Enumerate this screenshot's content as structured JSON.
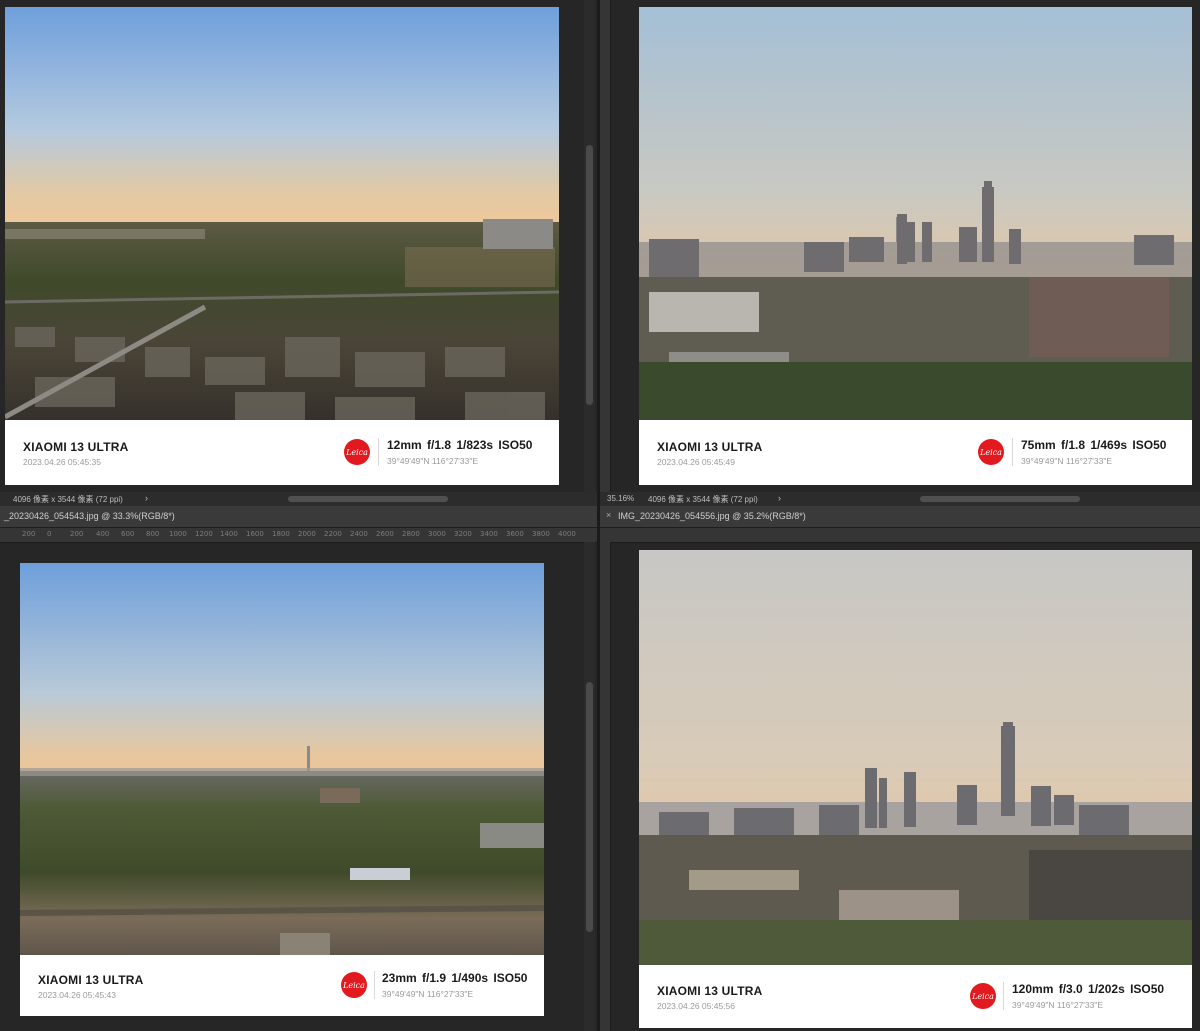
{
  "tabs": {
    "left": {
      "title": "_20230426_054543.jpg @ 33.3%(RGB/8*)"
    },
    "right": {
      "close": "×",
      "title": "IMG_20230426_054556.jpg @ 35.2%(RGB/8*)"
    }
  },
  "status": {
    "left": {
      "zoom": "",
      "dims": "4096 像素 x 3544 像素 (72 ppi)",
      "chevron": "›"
    },
    "right": {
      "zoom": "35.16%",
      "dims": "4096 像素 x 3544 像素 (72 ppi)",
      "chevron": "›"
    }
  },
  "ruler_labels": [
    "200",
    "0",
    "200",
    "400",
    "600",
    "800",
    "1000",
    "1200",
    "1400",
    "1600",
    "1800",
    "2000",
    "2200",
    "2400",
    "2600",
    "2800",
    "3000",
    "3200",
    "3400",
    "3600",
    "3800",
    "4000"
  ],
  "photos": [
    {
      "model": "XIAOMI 13 ULTRA",
      "datetime": "2023.04.26  05:45:35",
      "logo": "Leica",
      "specs": "12mm  f/1.8  1/823s  ISO50",
      "gps": "39°49'49\"N  116°27'33\"E"
    },
    {
      "model": "XIAOMI 13 ULTRA",
      "datetime": "2023.04.26  05:45:49",
      "logo": "Leica",
      "specs": "75mm  f/1.8  1/469s  ISO50",
      "gps": "39°49'49\"N  116°27'33\"E"
    },
    {
      "model": "XIAOMI 13 ULTRA",
      "datetime": "2023.04.26  05:45:43",
      "logo": "Leica",
      "specs": "23mm  f/1.9  1/490s  ISO50",
      "gps": "39°49'49\"N  116°27'33\"E"
    },
    {
      "model": "XIAOMI 13 ULTRA",
      "datetime": "2023.04.26  05:45:56",
      "logo": "Leica",
      "specs": "120mm  f/3.0  1/202s  ISO50",
      "gps": "39°49'49\"N  116°27'33\"E"
    }
  ],
  "colors": {
    "leica_red": "#e2191e",
    "workspace": "#262626",
    "chrome": "#3a3a3a"
  }
}
